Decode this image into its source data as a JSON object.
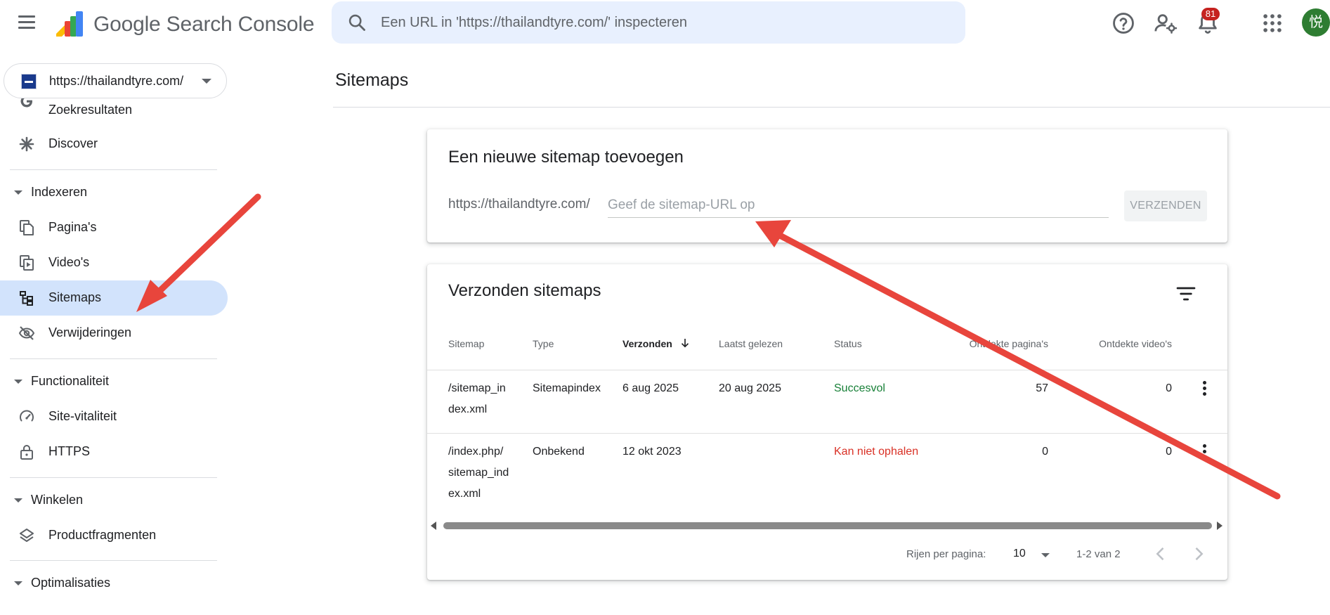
{
  "app": {
    "name": "Google Search Console"
  },
  "search": {
    "placeholder": "Een URL in 'https://thailandtyre.com/' inspecteren"
  },
  "notifications": {
    "count": "81"
  },
  "account": {
    "avatar_initial": "悦",
    "avatar_color": "#2e7d32"
  },
  "property": {
    "url": "https://thailandtyre.com/"
  },
  "sidebar": {
    "items": [
      {
        "label": "Zoekresultaten",
        "icon": "google-g-icon"
      },
      {
        "label": "Discover",
        "icon": "asterisk-icon"
      },
      {
        "label": "Pagina's",
        "icon": "pages-icon"
      },
      {
        "label": "Video's",
        "icon": "video-icon"
      },
      {
        "label": "Sitemaps",
        "icon": "sitemap-icon",
        "active": true
      },
      {
        "label": "Verwijderingen",
        "icon": "eye-off-icon"
      },
      {
        "label": "Site-vitaliteit",
        "icon": "gauge-icon"
      },
      {
        "label": "HTTPS",
        "icon": "lock-icon"
      },
      {
        "label": "Productfragmenten",
        "icon": "layers-icon"
      }
    ],
    "sections": [
      "Indexeren",
      "Functionaliteit",
      "Winkelen",
      "Optimalisaties"
    ]
  },
  "page": {
    "title": "Sitemaps"
  },
  "add_card": {
    "title": "Een nieuwe sitemap toevoegen",
    "prefix": "https://thailandtyre.com/",
    "placeholder": "Geef de sitemap-URL op",
    "submit_label": "VERZENDEN"
  },
  "table_card": {
    "title": "Verzonden sitemaps",
    "columns": [
      "Sitemap",
      "Type",
      "Verzonden",
      "Laatst gelezen",
      "Status",
      "Ontdekte pagina's",
      "Ontdekte video's"
    ],
    "sorted_column": "Verzonden",
    "rows": [
      {
        "sitemap": [
          "/sitemap_in",
          "dex.xml"
        ],
        "type": "Sitemapindex",
        "submitted": "6 aug 2025",
        "last_read": "20 aug 2025",
        "status": "Succesvol",
        "status_color": "#188038",
        "pages": "57",
        "videos": "0"
      },
      {
        "sitemap": [
          "/index.php/",
          "sitemap_ind",
          "ex.xml"
        ],
        "type": "Onbekend",
        "submitted": "12 okt 2023",
        "last_read": "",
        "status": "Kan niet ophalen",
        "status_color": "#d93025",
        "pages": "0",
        "videos": "0"
      }
    ],
    "pagination": {
      "rows_label": "Rijen per pagina:",
      "rows_value": "10",
      "range": "1-2 van 2"
    }
  },
  "annotation_color": "#e8453c"
}
